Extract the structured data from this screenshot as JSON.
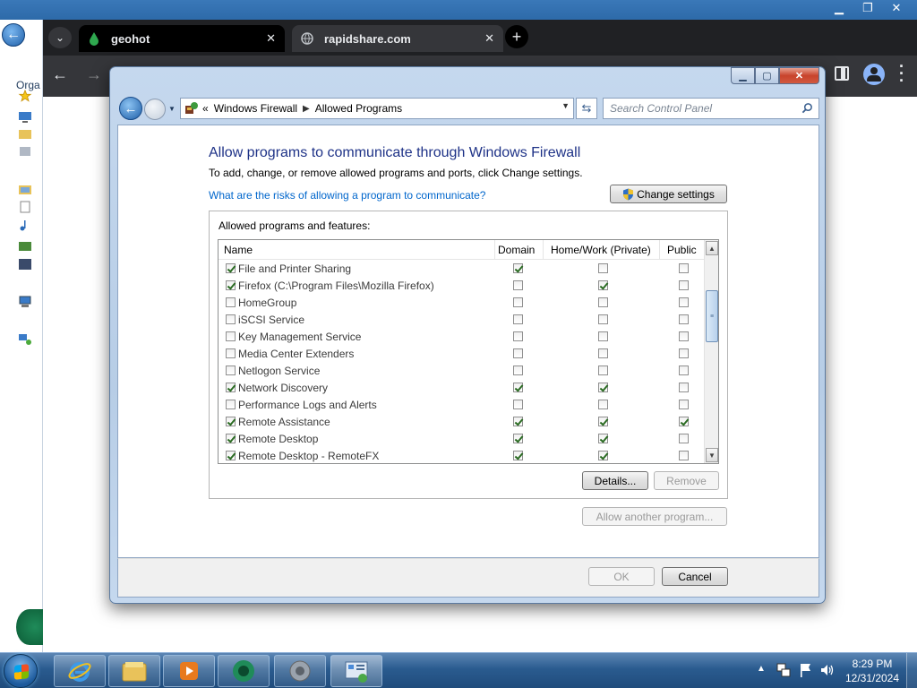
{
  "background_window": {
    "organize_label": "Orga"
  },
  "browser": {
    "tabs": [
      {
        "title": "geohot"
      },
      {
        "title": "rapidshare.com"
      }
    ],
    "close_glyph": "✕"
  },
  "dialog": {
    "address": {
      "root": "Windows Firewall",
      "current": "Allowed Programs"
    },
    "search_placeholder": "Search Control Panel",
    "title": "Allow programs to communicate through Windows Firewall",
    "subtitle": "To add, change, or remove allowed programs and ports, click Change settings.",
    "risks_link": "What are the risks of allowing a program to communicate?",
    "change_settings_label": "Change settings",
    "group_label": "Allowed programs and features:",
    "columns": {
      "name": "Name",
      "domain": "Domain",
      "private": "Home/Work (Private)",
      "public": "Public"
    },
    "programs": [
      {
        "name": "File and Printer Sharing",
        "enabled": true,
        "domain": true,
        "private": false,
        "public": false
      },
      {
        "name": "Firefox (C:\\Program Files\\Mozilla Firefox)",
        "enabled": true,
        "domain": false,
        "private": true,
        "public": false
      },
      {
        "name": "HomeGroup",
        "enabled": false,
        "domain": false,
        "private": false,
        "public": false
      },
      {
        "name": "iSCSI Service",
        "enabled": false,
        "domain": false,
        "private": false,
        "public": false
      },
      {
        "name": "Key Management Service",
        "enabled": false,
        "domain": false,
        "private": false,
        "public": false
      },
      {
        "name": "Media Center Extenders",
        "enabled": false,
        "domain": false,
        "private": false,
        "public": false
      },
      {
        "name": "Netlogon Service",
        "enabled": false,
        "domain": false,
        "private": false,
        "public": false
      },
      {
        "name": "Network Discovery",
        "enabled": true,
        "domain": true,
        "private": true,
        "public": false
      },
      {
        "name": "Performance Logs and Alerts",
        "enabled": false,
        "domain": false,
        "private": false,
        "public": false
      },
      {
        "name": "Remote Assistance",
        "enabled": true,
        "domain": true,
        "private": true,
        "public": true
      },
      {
        "name": "Remote Desktop",
        "enabled": true,
        "domain": true,
        "private": true,
        "public": false
      },
      {
        "name": "Remote Desktop - RemoteFX",
        "enabled": true,
        "domain": true,
        "private": true,
        "public": false
      }
    ],
    "details_label": "Details...",
    "remove_label": "Remove",
    "allow_another_label": "Allow another program...",
    "ok_label": "OK",
    "cancel_label": "Cancel"
  },
  "taskbar": {
    "time": "8:29 PM",
    "date": "12/31/2024"
  },
  "colors": {
    "link": "#0066cc",
    "title": "#1e3287",
    "taskbar": "#2a5b8f"
  }
}
